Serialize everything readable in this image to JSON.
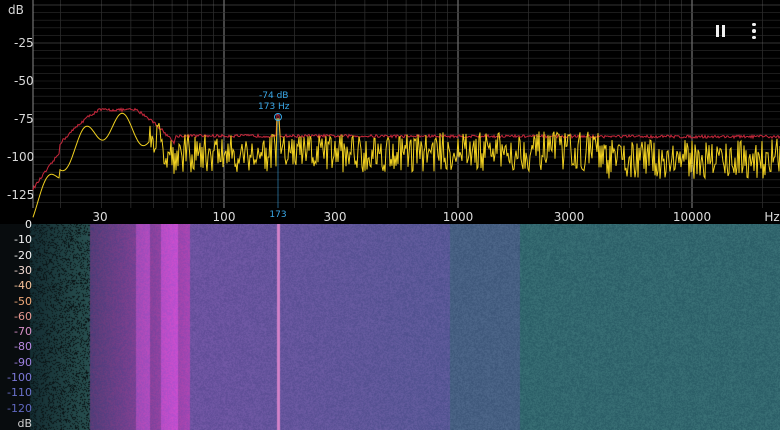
{
  "spectrum": {
    "unit_label": "dB",
    "y_ticks": [
      "-25",
      "-50",
      "-75",
      "-100",
      "-125"
    ],
    "x_ticks": [
      "30",
      "100",
      "300",
      "1000",
      "3000",
      "10000",
      "Hz"
    ],
    "marker_freq": "173",
    "peak_tooltip": {
      "db": "-74 dB",
      "freq": "173 Hz"
    },
    "colors": {
      "peak_hold": "#c8283c",
      "live": "#f0d020",
      "marker": "#3aa8e8"
    }
  },
  "controls": {
    "pause_icon": "pause-icon",
    "more_icon": "more-vert-icon"
  },
  "spectrogram": {
    "scale_labels": [
      "0",
      "-10",
      "-20",
      "-30",
      "-40",
      "-50",
      "-60",
      "-70",
      "-80",
      "-90",
      "-100",
      "-110",
      "-120",
      "dB"
    ],
    "scale_colors": [
      "#f2f2f2",
      "#f2f2f2",
      "#f2f2f2",
      "#f2d8d0",
      "#f4c098",
      "#f0a878",
      "#e89890",
      "#d890c8",
      "#b888e0",
      "#9c80e0",
      "#7c78d8",
      "#6a72cc",
      "#6068c0",
      "#d0d0d0"
    ]
  }
}
